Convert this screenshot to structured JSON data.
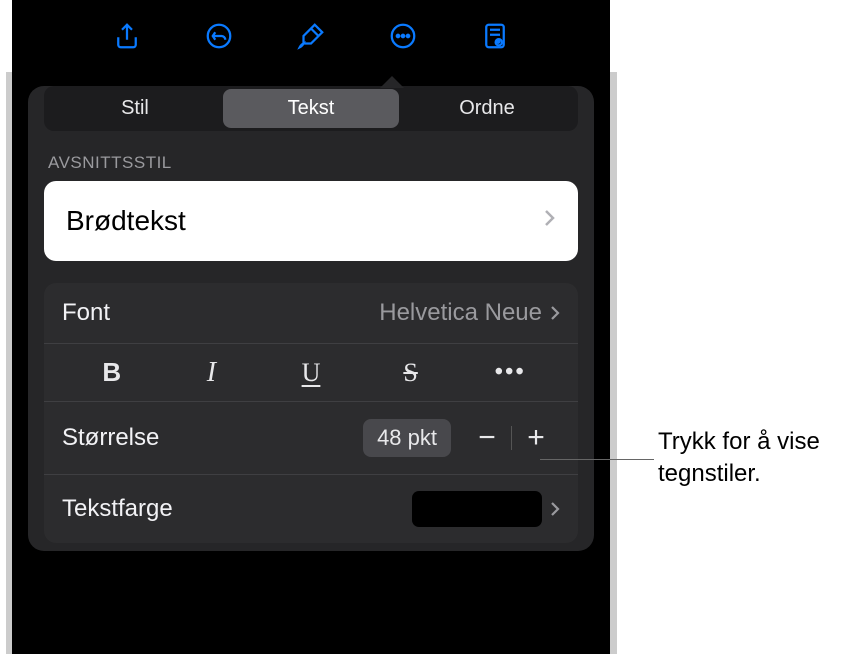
{
  "toolbar": {
    "icons": [
      "share-icon",
      "undo-icon",
      "brush-icon",
      "more-circle-icon",
      "doc-view-icon"
    ]
  },
  "tabs": {
    "items": [
      "Stil",
      "Tekst",
      "Ordne"
    ],
    "active_index": 1
  },
  "paragraph_style": {
    "section_label": "AVSNITTSSTIL",
    "value": "Brødtekst"
  },
  "font": {
    "label": "Font",
    "value": "Helvetica Neue"
  },
  "styles": {
    "bold": "B",
    "italic": "I",
    "underline": "U",
    "strike": "S",
    "more": "•••"
  },
  "size": {
    "label": "Størrelse",
    "value": "48 pkt",
    "minus": "−",
    "plus": "+"
  },
  "text_color": {
    "label": "Tekstfarge",
    "swatch": "#000000"
  },
  "callout": {
    "line1": "Trykk for å vise",
    "line2": "tegnstiler."
  }
}
